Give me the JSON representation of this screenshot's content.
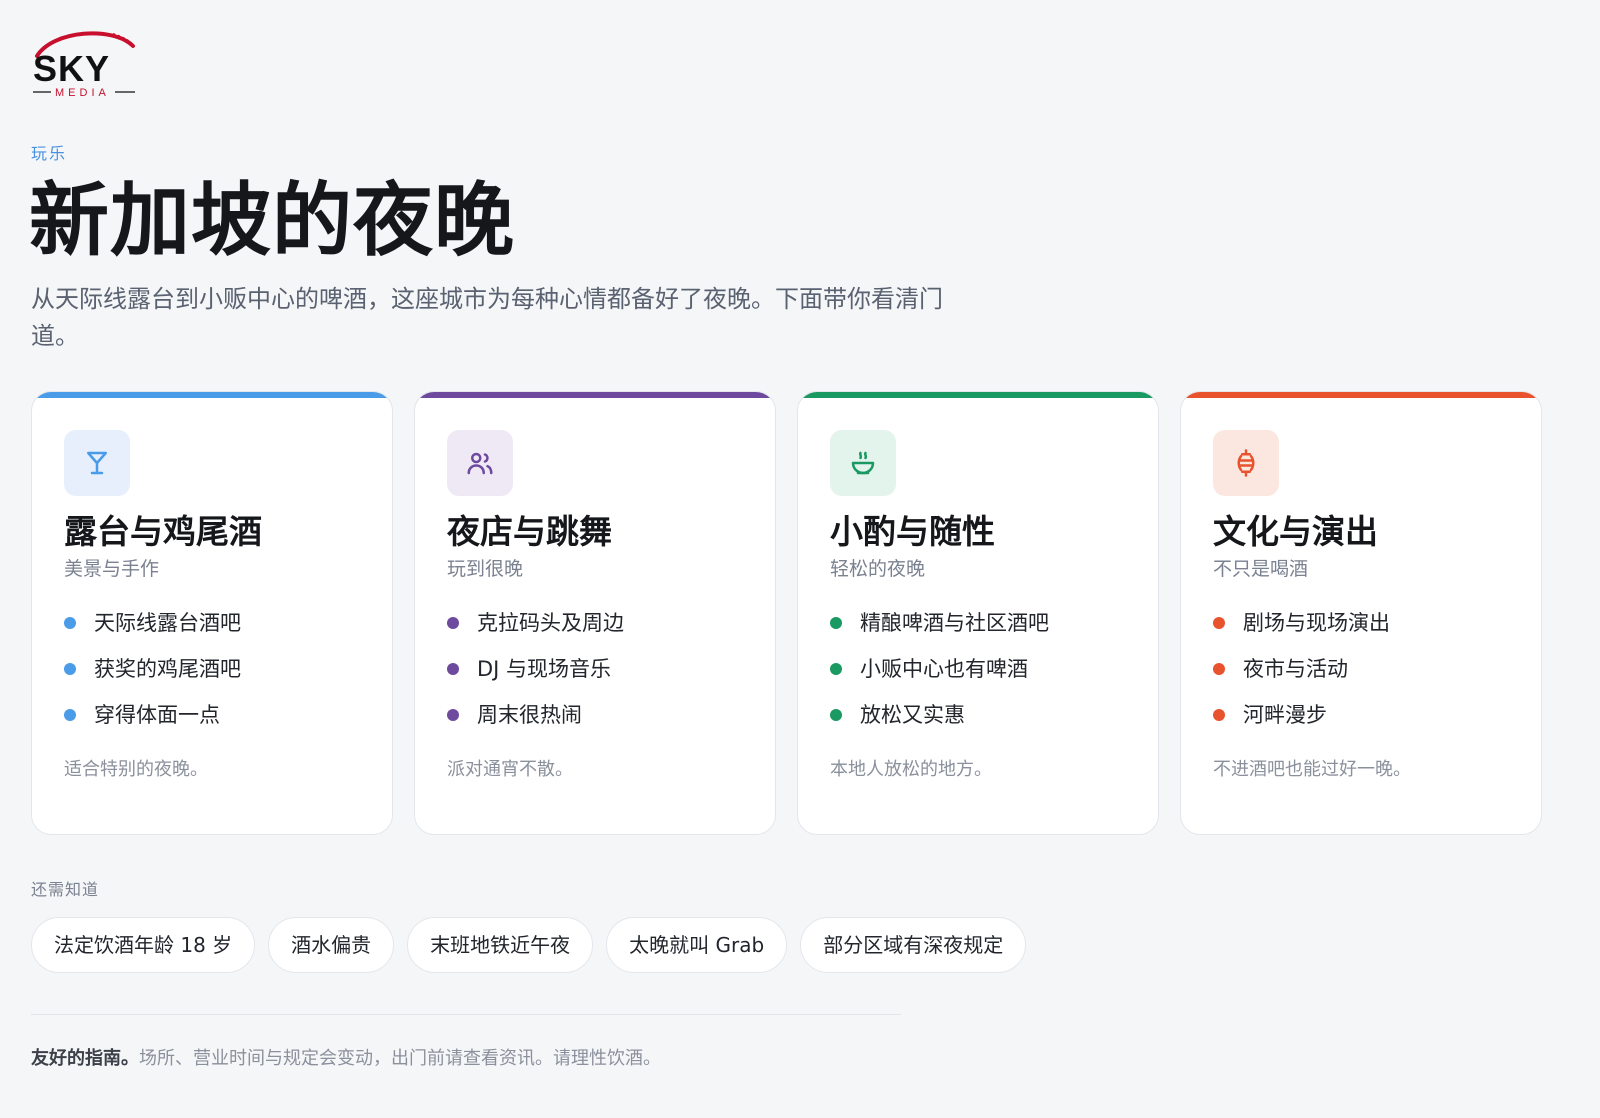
{
  "brand": {
    "name": "SKY",
    "tagline": "MEDIA"
  },
  "eyebrow": "玩乐",
  "title": "新加坡的夜晚",
  "lead": "从天际线露台到小贩中心的啤酒，这座城市为每种心情都备好了夜晚。下面带你看清门道。",
  "cards": [
    {
      "icon": "cocktail-glass-icon",
      "accent": "#4a9be8",
      "icon_bg": "#e6effb",
      "title": "露台与鸡尾酒",
      "subtitle": "美景与手作",
      "items": [
        "天际线露台酒吧",
        "获奖的鸡尾酒吧",
        "穿得体面一点"
      ],
      "note": "适合特别的夜晚。"
    },
    {
      "icon": "people-icon",
      "accent": "#6e4a9e",
      "icon_bg": "#efe9f5",
      "title": "夜店与跳舞",
      "subtitle": "玩到很晚",
      "items": [
        "克拉码头及周边",
        "DJ 与现场音乐",
        "周末很热闹"
      ],
      "note": "派对通宵不散。"
    },
    {
      "icon": "bowl-icon",
      "accent": "#1a9a62",
      "icon_bg": "#e3f4ec",
      "title": "小酌与随性",
      "subtitle": "轻松的夜晚",
      "items": [
        "精酿啤酒与社区酒吧",
        "小贩中心也有啤酒",
        "放松又实惠"
      ],
      "note": "本地人放松的地方。"
    },
    {
      "icon": "lantern-icon",
      "accent": "#e8532e",
      "icon_bg": "#fbe7e0",
      "title": "文化与演出",
      "subtitle": "不只是喝酒",
      "items": [
        "剧场与现场演出",
        "夜市与活动",
        "河畔漫步"
      ],
      "note": "不进酒吧也能过好一晚。"
    }
  ],
  "know": {
    "label": "还需知道",
    "pills": [
      "法定饮酒年龄 18 岁",
      "酒水偏贵",
      "末班地铁近午夜",
      "太晚就叫 Grab",
      "部分区域有深夜规定"
    ]
  },
  "footer": {
    "strong": "友好的指南。",
    "text": "场所、营业时间与规定会变动，出门前请查看资讯。请理性饮酒。"
  }
}
